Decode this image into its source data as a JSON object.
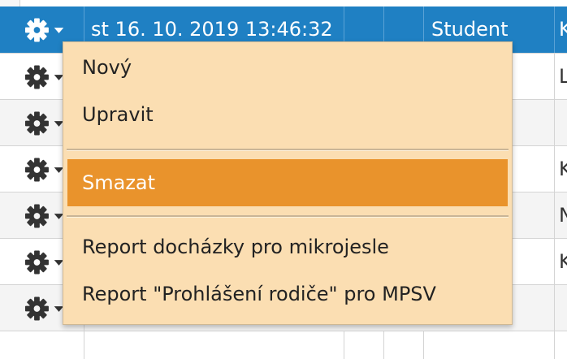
{
  "table": {
    "selected_row": {
      "date": "st 16. 10. 2019 13:46:32",
      "role": "Student",
      "extra": "K"
    },
    "row_edge_letters": [
      "L",
      "",
      "K",
      "N",
      "K",
      ""
    ]
  },
  "context_menu": {
    "items": [
      {
        "label": "Nový"
      },
      {
        "label": "Upravit"
      },
      {
        "label": "Smazat"
      },
      {
        "label": "Report docházky pro mikrojesle"
      },
      {
        "label": "Report \"Prohlášení rodiče\" pro MPSV"
      }
    ],
    "active_item": "Smazat",
    "highlight_color": "#e9932c",
    "background_color": "#fbdeb2"
  },
  "colors": {
    "selected_row": "#1f80c3"
  },
  "icons": {
    "row_menu": "gear-dropdown-icon"
  }
}
